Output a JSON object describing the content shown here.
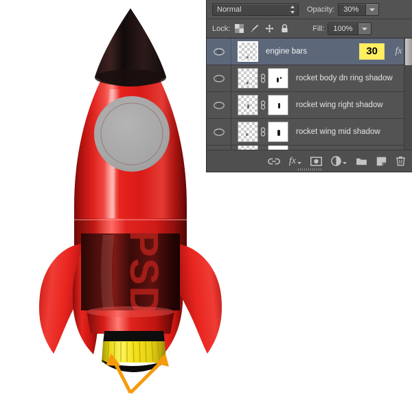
{
  "panel": {
    "blend_mode": {
      "label": "Normal",
      "name": "blend-mode-select"
    },
    "opacity": {
      "label": "Opacity:",
      "value": "30%"
    },
    "lock": {
      "label": "Lock:",
      "icons": [
        "transparency-checker-icon",
        "brush-icon",
        "move-icon",
        "lock-icon"
      ]
    },
    "fill": {
      "label": "Fill:",
      "value": "100%"
    },
    "layers": [
      {
        "name": "engine bars",
        "selected": true,
        "visible": true,
        "has_mask": false,
        "linked": false,
        "badge": "30",
        "fx": "fx"
      },
      {
        "name": "rocket body dn ring shadow",
        "selected": false,
        "visible": true,
        "has_mask": true,
        "linked": true,
        "badge": "",
        "fx": ""
      },
      {
        "name": "rocket wing right shadow",
        "selected": false,
        "visible": true,
        "has_mask": true,
        "linked": true,
        "badge": "",
        "fx": ""
      },
      {
        "name": "rocket wing mid shadow",
        "selected": false,
        "visible": true,
        "has_mask": true,
        "linked": true,
        "badge": "",
        "fx": ""
      }
    ],
    "toolbar": [
      {
        "icon": "link-layers-icon",
        "label": ""
      },
      {
        "icon": "layer-style-fx-icon",
        "label": "fx"
      },
      {
        "icon": "add-layer-mask-icon",
        "label": ""
      },
      {
        "icon": "adjustment-layer-icon",
        "label": ""
      },
      {
        "icon": "new-group-icon",
        "label": ""
      },
      {
        "icon": "new-layer-icon",
        "label": ""
      },
      {
        "icon": "delete-layer-icon",
        "label": ""
      }
    ]
  },
  "canvas": {
    "rocket_label": "PSD",
    "colors": {
      "body_red": "#e0231f",
      "body_red_dark": "#8e0e0c",
      "nose_black": "#19100f",
      "engine_yellow": "#f5e31a",
      "engine_black": "#111111",
      "porthole_gray": "#a8a8a8",
      "arrow_orange": "#f59b0b"
    }
  }
}
